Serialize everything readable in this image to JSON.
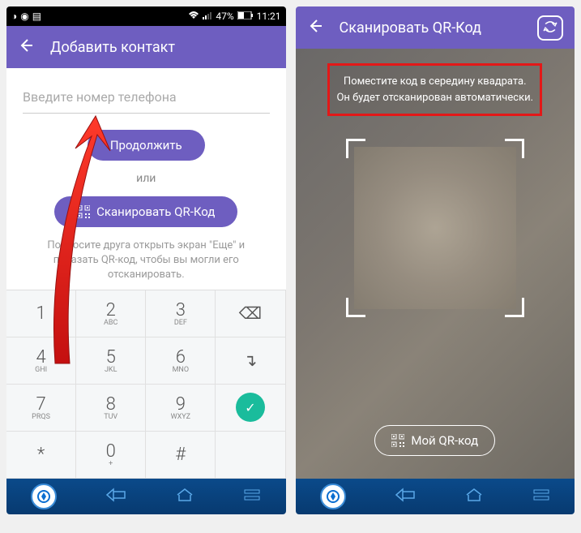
{
  "status": {
    "battery": "47%",
    "time": "11:21"
  },
  "screen1": {
    "header": {
      "title": "Добавить контакт"
    },
    "input": {
      "placeholder": "Введите номер телефона",
      "value": ""
    },
    "continue_label": "Продолжить",
    "or_label": "или",
    "scan_label": "Сканировать QR-Код",
    "help_text": "Попросите друга открыть экран \"Еще\" и показать QR-код, чтобы вы могли его отсканировать.",
    "keypad": {
      "rows": [
        [
          {
            "n": "1",
            "l": ""
          },
          {
            "n": "2",
            "l": "ABC"
          },
          {
            "n": "3",
            "l": "DEF"
          },
          {
            "action": "backspace",
            "sym": "⌫"
          }
        ],
        [
          {
            "n": "4",
            "l": "GHI"
          },
          {
            "n": "5",
            "l": "JKL"
          },
          {
            "n": "6",
            "l": "MNO"
          },
          {
            "action": "next",
            "sym": "↴"
          }
        ],
        [
          {
            "n": "7",
            "l": "PRQS"
          },
          {
            "n": "8",
            "l": "TUV"
          },
          {
            "n": "9",
            "l": "WXYZ"
          },
          {
            "action": "confirm",
            "sym": "✓"
          }
        ],
        [
          {
            "n": "*",
            "l": ""
          },
          {
            "n": "0",
            "l": "+"
          },
          {
            "n": "#",
            "l": ""
          },
          {
            "action": "empty",
            "sym": ""
          }
        ]
      ]
    }
  },
  "screen2": {
    "header": {
      "title": "Сканировать QR-Код"
    },
    "instruction_line1": "Поместите код в середину квадрата.",
    "instruction_line2": "Он будет отсканирован автоматически.",
    "my_qr_label": "Мой QR-код"
  }
}
